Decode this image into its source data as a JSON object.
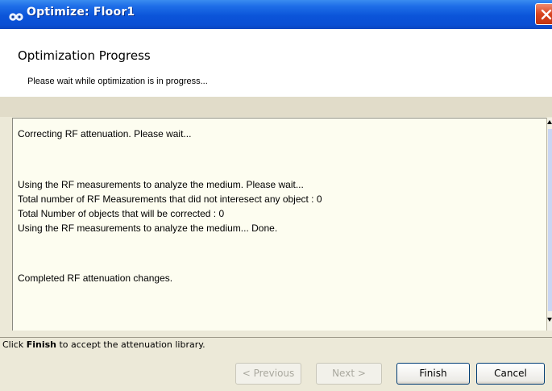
{
  "window": {
    "title": "Optimize: Floor1",
    "app_icon": "binoculars-icon",
    "close_icon": "close-icon"
  },
  "header": {
    "title": "Optimization Progress",
    "subtitle": "Please wait while optimization is in progress..."
  },
  "log": {
    "lines": [
      "Correcting RF attenuation. Please wait...",
      "",
      "",
      "Using the RF measurements to analyze the medium. Please wait...",
      "Total number of RF Measurements that did not interesect any object : 0",
      "Total Number of objects that will be corrected : 0",
      "Using the RF measurements to analyze the medium... Done.",
      "",
      "",
      "Completed RF attenuation changes."
    ]
  },
  "status": {
    "prefix": "Click ",
    "bold": "Finish",
    "suffix": " to accept the attenuation library."
  },
  "buttons": {
    "previous": "< Previous",
    "next": "Next >",
    "finish": "Finish",
    "cancel": "Cancel"
  },
  "colors": {
    "titlebar": "#0a4fd4",
    "log_background": "#fdfdf0",
    "dialog_background": "#ece9d8",
    "band": "#e1dcc9"
  }
}
